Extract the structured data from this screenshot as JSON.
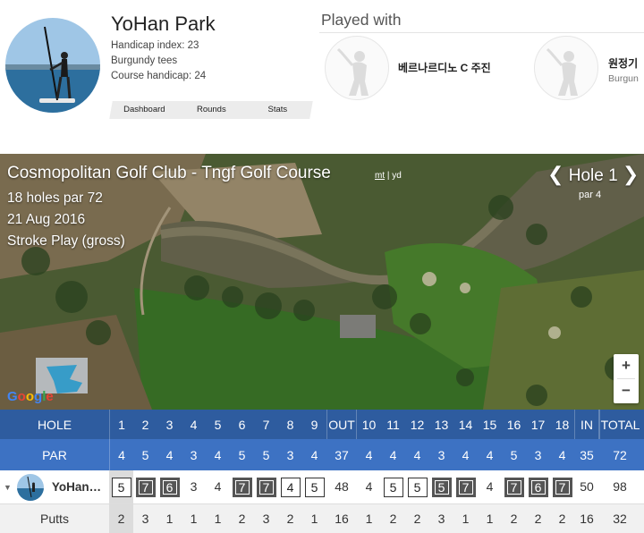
{
  "profile": {
    "name": "YoHan Park",
    "handicap_index": "Handicap index: 23",
    "tees": "Burgundy tees",
    "course_handicap": "Course handicap: 24",
    "tabs": [
      "Dashboard",
      "Rounds",
      "Stats"
    ]
  },
  "played_with": {
    "title": "Played with",
    "partners": [
      {
        "name": "베르나르디노 C 주진",
        "sub": ""
      },
      {
        "name": "원정기",
        "sub": "Burgun"
      }
    ]
  },
  "course": {
    "title": "Cosmopolitan Golf Club - Tngf Golf Course",
    "unit_mt": "mt",
    "unit_sep": "|",
    "unit_yd": "yd",
    "holes_par": "18 holes par 72",
    "date": "21 Aug 2016",
    "format": "Stroke Play (gross)"
  },
  "hole_nav": {
    "prev": "❮",
    "label": "Hole 1",
    "next": "❯",
    "par": "par 4"
  },
  "map_controls": {
    "zoom_in": "+",
    "zoom_out": "−",
    "attribution": "Google"
  },
  "colors": {
    "header_blue": "#2e5c9f",
    "par_blue": "#3d72c3",
    "map_green": "#5a6b3c"
  },
  "scorecard": {
    "hole_label": "HOLE",
    "par_label": "PAR",
    "putts_label": "Putts",
    "player_label": "YoHan…",
    "holes": [
      "1",
      "2",
      "3",
      "4",
      "5",
      "6",
      "7",
      "8",
      "9",
      "OUT",
      "10",
      "11",
      "12",
      "13",
      "14",
      "15",
      "16",
      "17",
      "18",
      "IN",
      "TOTAL"
    ],
    "par": [
      "4",
      "5",
      "4",
      "3",
      "4",
      "5",
      "5",
      "3",
      "4",
      "37",
      "4",
      "4",
      "4",
      "3",
      "4",
      "4",
      "5",
      "3",
      "4",
      "35",
      "72"
    ],
    "scores": [
      "5",
      "7",
      "6",
      "3",
      "4",
      "7",
      "7",
      "4",
      "5",
      "48",
      "4",
      "5",
      "5",
      "5",
      "7",
      "4",
      "7",
      "6",
      "7",
      "50",
      "98"
    ],
    "score_types": [
      "bogey",
      "dbl",
      "dbl",
      "par",
      "par",
      "dbl",
      "dbl",
      "bogey",
      "bogey",
      "sum",
      "par",
      "bogey",
      "bogey",
      "dbl",
      "dbl",
      "par",
      "dbl",
      "dbl",
      "dbl",
      "sum",
      "sum"
    ],
    "putts": [
      "2",
      "3",
      "1",
      "1",
      "1",
      "2",
      "3",
      "2",
      "1",
      "16",
      "1",
      "2",
      "2",
      "3",
      "1",
      "1",
      "2",
      "2",
      "2",
      "16",
      "32"
    ]
  }
}
